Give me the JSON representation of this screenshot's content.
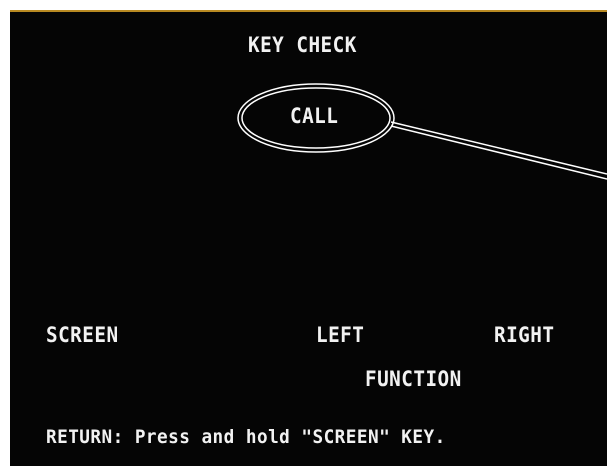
{
  "screen": {
    "title": "KEY CHECK",
    "highlighted_key": "CALL",
    "keys": {
      "screen": "SCREEN",
      "left": "LEFT",
      "right": "RIGHT",
      "function": "FUNCTION"
    },
    "return_instruction": "RETURN: Press and hold \"SCREEN\" KEY."
  },
  "annotation": {
    "type": "double-ellipse callout",
    "target": "CALL"
  },
  "colors": {
    "screen_background": "#050505",
    "text": "#f2f2f2",
    "annotation_line": "#ffffff",
    "frame_edge": "#b98a22",
    "page_background": "#ffffff"
  }
}
